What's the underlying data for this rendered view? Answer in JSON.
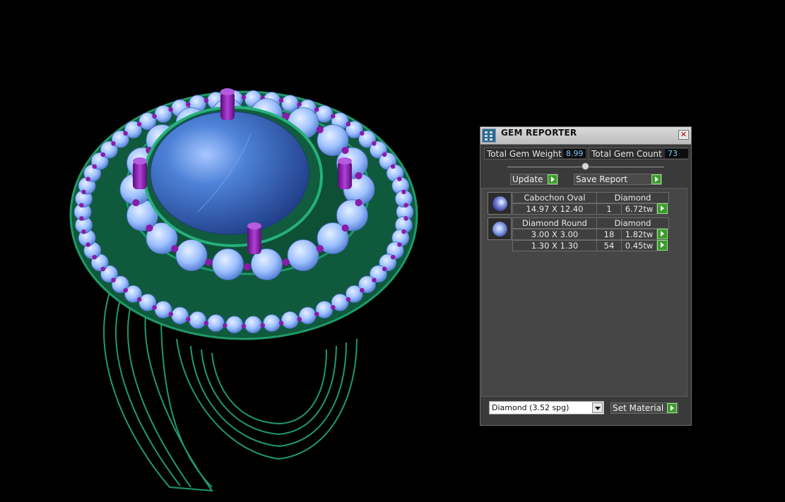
{
  "viewport": {
    "description_icon": "3d-ring-model"
  },
  "panel": {
    "title": "GEM REPORTER",
    "total_weight_label": "Total Gem Weight",
    "total_weight_value": "8.99",
    "total_count_label": "Total Gem Count",
    "total_count_value": "73",
    "update_label": "Update",
    "save_label": "Save Report",
    "groups": [
      {
        "name": "Cabochon Oval",
        "material": "Diamond",
        "rows": [
          {
            "size": "14.97 X 12.40",
            "count": "1",
            "weight": "6.72tw"
          }
        ]
      },
      {
        "name": "Diamond Round",
        "material": "Diamond",
        "rows": [
          {
            "size": "3.00 X 3.00",
            "count": "18",
            "weight": "1.82tw"
          },
          {
            "size": "1.30 X 1.30",
            "count": "54",
            "weight": "0.45tw"
          }
        ]
      }
    ],
    "material_select": "Diamond     (3.52 spg)",
    "set_material_label": "Set Material"
  },
  "colors": {
    "metal": "#1f9a6a",
    "stone": "#8fb8ff",
    "center": "#3f70c8",
    "prong": "#8a1aa8",
    "accent_value": "#7ec8f5",
    "go_button": "#3c9b2c"
  }
}
